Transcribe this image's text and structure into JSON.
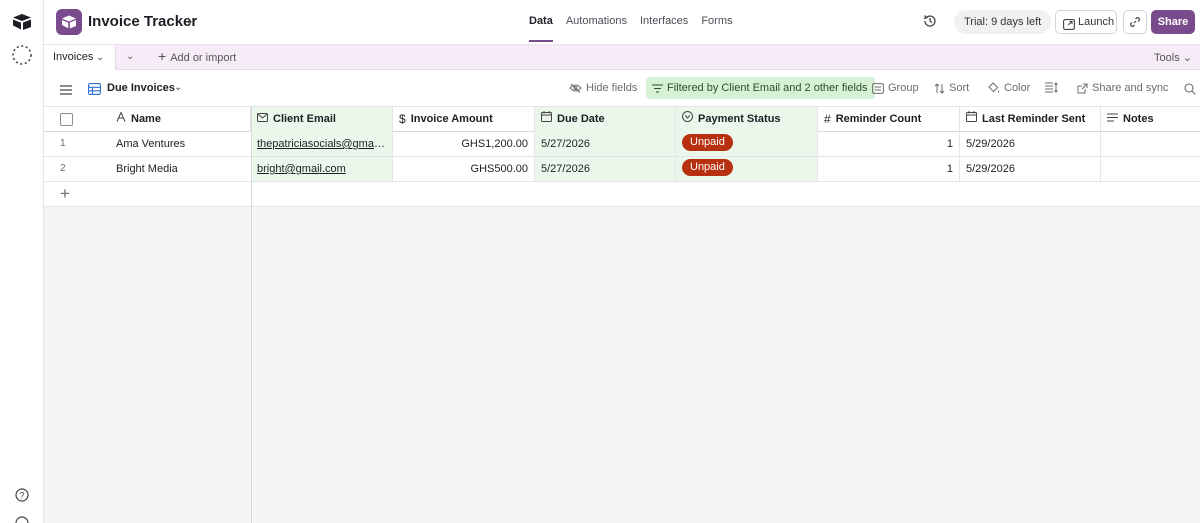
{
  "rail": {
    "help_icon": "question-icon"
  },
  "header": {
    "base_title": "Invoice Tracker",
    "nav": [
      "Data",
      "Automations",
      "Interfaces",
      "Forms"
    ],
    "trial": "Trial: 9 days left",
    "launch": "Launch",
    "share": "Share",
    "brand_color": "#7a4b8c"
  },
  "tabs": {
    "active": "Invoices",
    "add_import": "Add or import",
    "tools": "Tools"
  },
  "toolbar": {
    "view_name": "Due Invoices",
    "hide_fields": "Hide fields",
    "filter": "Filtered by Client Email and 2 other fields",
    "group": "Group",
    "sort": "Sort",
    "color": "Color",
    "share_sync": "Share and sync"
  },
  "columns": [
    "Name",
    "Client Email",
    "Invoice Amount",
    "Due Date",
    "Payment Status",
    "Reminder Count",
    "Last Reminder Sent",
    "Notes"
  ],
  "rows": [
    {
      "num": "1",
      "name": "Ama Ventures",
      "email": "thepatriciasocials@gmail.com",
      "amount": "GHS1,200.00",
      "due": "5/27/2026",
      "status": "Unpaid",
      "count": "1",
      "last_sent": "5/29/2026",
      "notes": ""
    },
    {
      "num": "2",
      "name": "Bright Media",
      "email": "bright@gmail.com",
      "amount": "GHS500.00",
      "due": "5/27/2026",
      "status": "Unpaid",
      "count": "1",
      "last_sent": "5/29/2026",
      "notes": ""
    }
  ],
  "colors": {
    "unpaid": "#b7300f",
    "filtered_col": "#eaf7ea",
    "filter_chip": "#d7f1d7"
  }
}
